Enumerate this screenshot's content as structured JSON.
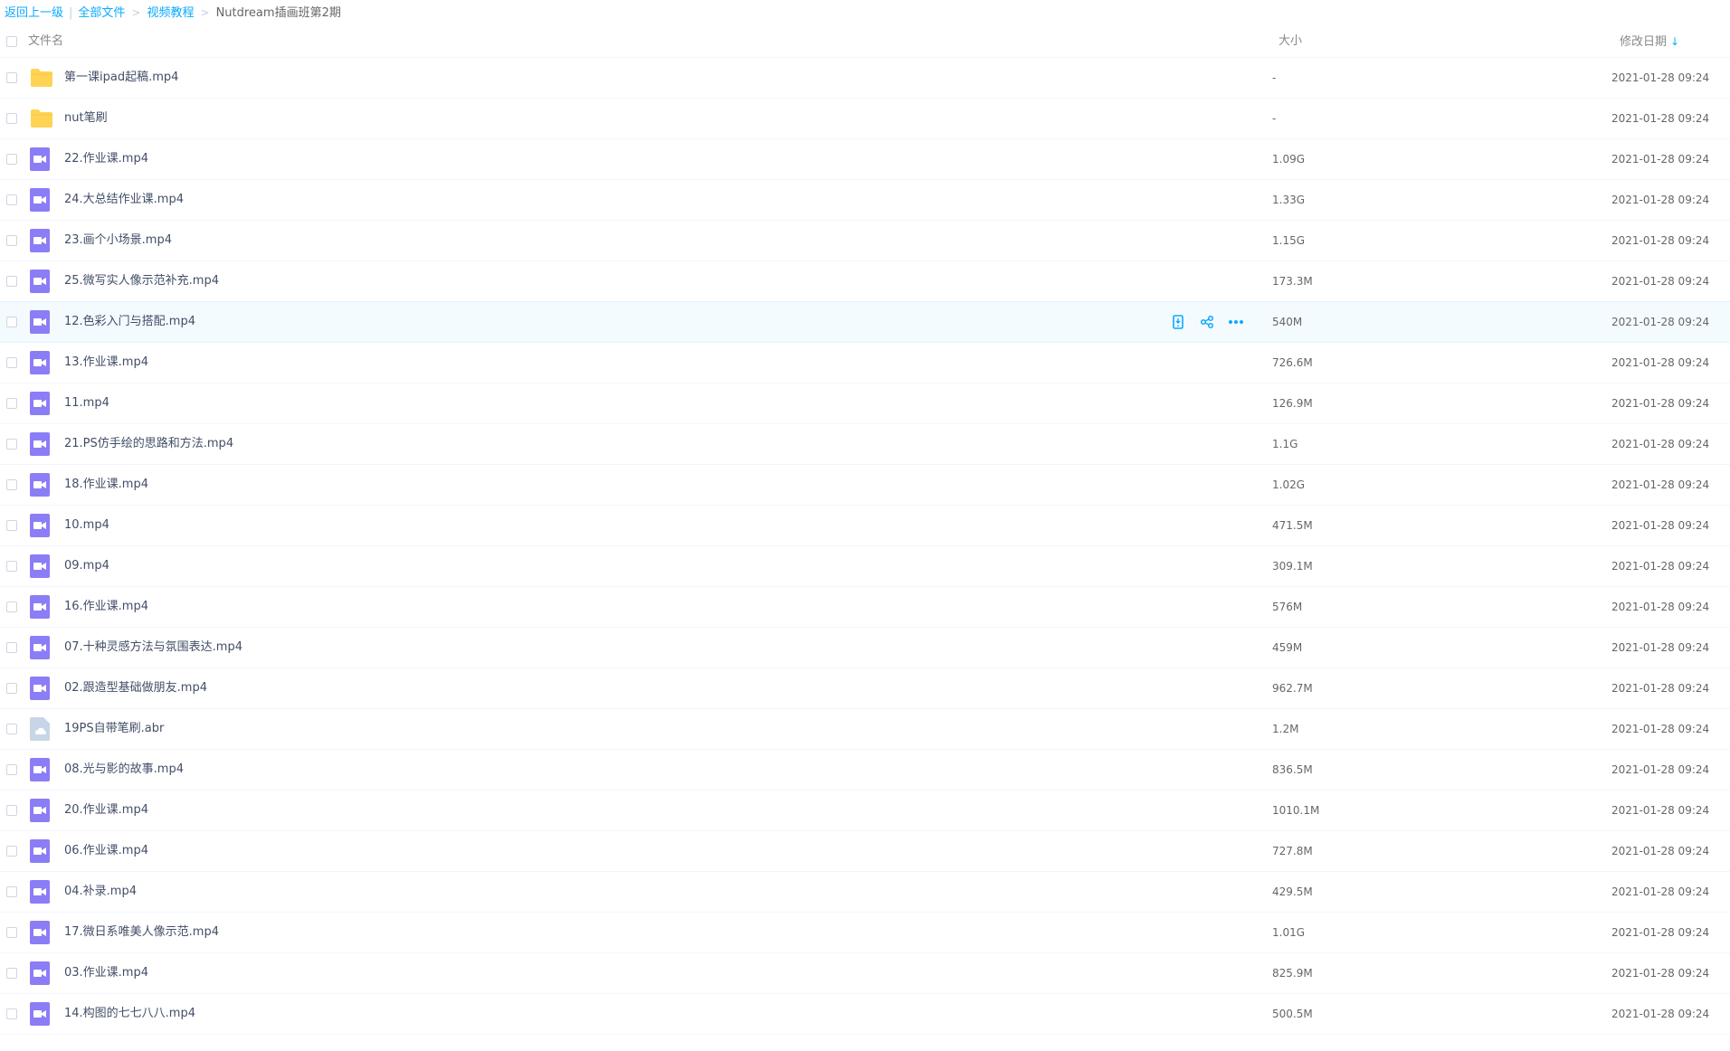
{
  "breadcrumb": {
    "back": "返回上一级",
    "all_files": "全部文件",
    "video": "视频教程",
    "current": "Nutdream插画班第2期",
    "separator": ">",
    "divider": "|"
  },
  "columns": {
    "name": "文件名",
    "size": "大小",
    "date": "修改日期",
    "sort_arrow": "↓"
  },
  "colors": {
    "link": "#09aaff",
    "folder": "#ffd455",
    "video": "#8b7df5",
    "generic_file": "#c6d6e6"
  },
  "rows": [
    {
      "name": "第一课ipad起稿.mp4",
      "size": "-",
      "date": "2021-01-28 09:24",
      "icon": "folder-icon"
    },
    {
      "name": "nut笔刷",
      "size": "-",
      "date": "2021-01-28 09:24",
      "icon": "folder-icon"
    },
    {
      "name": "22.作业课.mp4",
      "size": "1.09G",
      "date": "2021-01-28 09:24",
      "icon": "video-file-icon"
    },
    {
      "name": "24.大总结作业课.mp4",
      "size": "1.33G",
      "date": "2021-01-28 09:24",
      "icon": "video-file-icon"
    },
    {
      "name": "23.画个小场景.mp4",
      "size": "1.15G",
      "date": "2021-01-28 09:24",
      "icon": "video-file-icon"
    },
    {
      "name": "25.微写实人像示范补充.mp4",
      "size": "173.3M",
      "date": "2021-01-28 09:24",
      "icon": "video-file-icon"
    },
    {
      "name": "12.色彩入门与搭配.mp4",
      "size": "540M",
      "date": "2021-01-28 09:24",
      "icon": "video-file-icon",
      "hover": true
    },
    {
      "name": "13.作业课.mp4",
      "size": "726.6M",
      "date": "2021-01-28 09:24",
      "icon": "video-file-icon"
    },
    {
      "name": "11.mp4",
      "size": "126.9M",
      "date": "2021-01-28 09:24",
      "icon": "video-file-icon"
    },
    {
      "name": "21.PS仿手绘的思路和方法.mp4",
      "size": "1.1G",
      "date": "2021-01-28 09:24",
      "icon": "video-file-icon"
    },
    {
      "name": "18.作业课.mp4",
      "size": "1.02G",
      "date": "2021-01-28 09:24",
      "icon": "video-file-icon"
    },
    {
      "name": "10.mp4",
      "size": "471.5M",
      "date": "2021-01-28 09:24",
      "icon": "video-file-icon"
    },
    {
      "name": "09.mp4",
      "size": "309.1M",
      "date": "2021-01-28 09:24",
      "icon": "video-file-icon"
    },
    {
      "name": "16.作业课.mp4",
      "size": "576M",
      "date": "2021-01-28 09:24",
      "icon": "video-file-icon"
    },
    {
      "name": "07.十种灵感方法与氛围表达.mp4",
      "size": "459M",
      "date": "2021-01-28 09:24",
      "icon": "video-file-icon"
    },
    {
      "name": "02.跟造型基础做朋友.mp4",
      "size": "962.7M",
      "date": "2021-01-28 09:24",
      "icon": "video-file-icon"
    },
    {
      "name": "19PS自带笔刷.abr",
      "size": "1.2M",
      "date": "2021-01-28 09:24",
      "icon": "generic-file-icon"
    },
    {
      "name": "08.光与影的故事.mp4",
      "size": "836.5M",
      "date": "2021-01-28 09:24",
      "icon": "video-file-icon"
    },
    {
      "name": "20.作业课.mp4",
      "size": "1010.1M",
      "date": "2021-01-28 09:24",
      "icon": "video-file-icon"
    },
    {
      "name": "06.作业课.mp4",
      "size": "727.8M",
      "date": "2021-01-28 09:24",
      "icon": "video-file-icon"
    },
    {
      "name": "04.补录.mp4",
      "size": "429.5M",
      "date": "2021-01-28 09:24",
      "icon": "video-file-icon"
    },
    {
      "name": "17.微日系唯美人像示范.mp4",
      "size": "1.01G",
      "date": "2021-01-28 09:24",
      "icon": "video-file-icon"
    },
    {
      "name": "03.作业课.mp4",
      "size": "825.9M",
      "date": "2021-01-28 09:24",
      "icon": "video-file-icon"
    },
    {
      "name": "14.构图的七七八八.mp4",
      "size": "500.5M",
      "date": "2021-01-28 09:24",
      "icon": "video-file-icon"
    }
  ],
  "row_actions": [
    "phone-download-icon",
    "share-icon",
    "more-icon"
  ]
}
